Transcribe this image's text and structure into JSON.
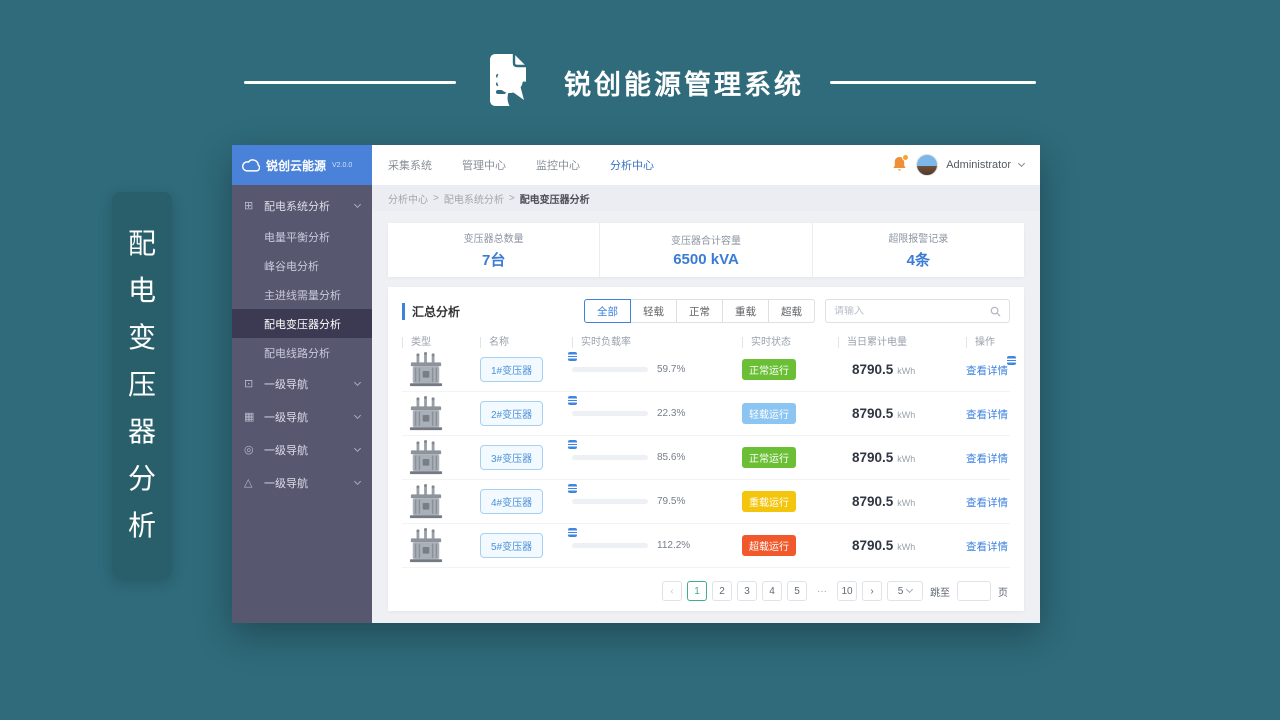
{
  "headline": {
    "title": "锐创能源管理系统"
  },
  "side_banner": {
    "text": "配电变压器分析"
  },
  "app": {
    "sidebar": {
      "logo_text": "锐创云能源",
      "version": "V2.0.0",
      "parent": {
        "label": "配电系统分析"
      },
      "submenu": [
        {
          "label": "电量平衡分析"
        },
        {
          "label": "峰谷电分析"
        },
        {
          "label": "主进线需量分析"
        },
        {
          "label": "配电变压器分析"
        },
        {
          "label": "配电线路分析"
        }
      ],
      "active_item": "配电变压器分析",
      "nav_items": [
        {
          "label": "一级导航"
        },
        {
          "label": "一级导航"
        },
        {
          "label": "一级导航"
        },
        {
          "label": "一级导航"
        }
      ]
    },
    "topnav": {
      "items": [
        "采集系统",
        "管理中心",
        "监控中心",
        "分析中心"
      ],
      "active": "分析中心",
      "user": "Administrator"
    },
    "breadcrumb": {
      "items": [
        "分析中心",
        "配电系统分析",
        "配电变压器分析"
      ],
      "separator": ">"
    },
    "stats": [
      {
        "label": "变压器总数量",
        "value": "7台"
      },
      {
        "label": "变压器合计容量",
        "value": "6500 kVA"
      },
      {
        "label": "超限报警记录",
        "value": "4条"
      }
    ],
    "summary": {
      "title": "汇总分析",
      "filters": [
        {
          "label": "全部"
        },
        {
          "label": "轻载"
        },
        {
          "label": "正常"
        },
        {
          "label": "重载"
        },
        {
          "label": "超载"
        }
      ],
      "active_filter": "全部",
      "search_placeholder": "请输入",
      "table": {
        "headers": [
          "类型",
          "名称",
          "实时负载率",
          "实时状态",
          "当日累计电量",
          "操作"
        ],
        "unit": "kWh",
        "rows": [
          {
            "name": "1#变压器",
            "load_label": "59.7%",
            "load_pct": 59.7,
            "status": "正常运行",
            "status_type": "normal",
            "energy": "8790.5",
            "action": "查看详情"
          },
          {
            "name": "2#变压器",
            "load_label": "22.3%",
            "load_pct": 22.3,
            "status": "轻载运行",
            "status_type": "light",
            "energy": "8790.5",
            "action": "查看详情"
          },
          {
            "name": "3#变压器",
            "load_label": "85.6%",
            "load_pct": 85.6,
            "status": "正常运行",
            "status_type": "normal",
            "energy": "8790.5",
            "action": "查看详情"
          },
          {
            "name": "4#变压器",
            "load_label": "79.5%",
            "load_pct": 79.5,
            "status": "重载运行",
            "status_type": "heavy",
            "energy": "8790.5",
            "action": "查看详情"
          },
          {
            "name": "5#变压器",
            "load_label": "112.2%",
            "load_pct": 112.2,
            "status": "超载运行",
            "status_type": "over",
            "energy": "8790.5",
            "action": "查看详情"
          }
        ]
      },
      "pagination": {
        "prev": "‹",
        "next": "›",
        "pages": [
          "1",
          "2",
          "3",
          "4",
          "5",
          "···",
          "10"
        ],
        "current": "1",
        "size_value": "5",
        "jump_label": "跳至",
        "page_suffix": "页"
      }
    }
  },
  "colors": {
    "background_teal": "#2f6b7b",
    "sidebar": "#585770",
    "logo_bar": "#4a82d9",
    "accent_blue": "#3d82e0",
    "stat_value_blue": "#3a7cd5",
    "status_normal": "#6abf35",
    "status_light": "#8cc5f2",
    "status_heavy": "#f4c50d",
    "status_over": "#f1582c",
    "pagination_active": "#3fae8e"
  }
}
